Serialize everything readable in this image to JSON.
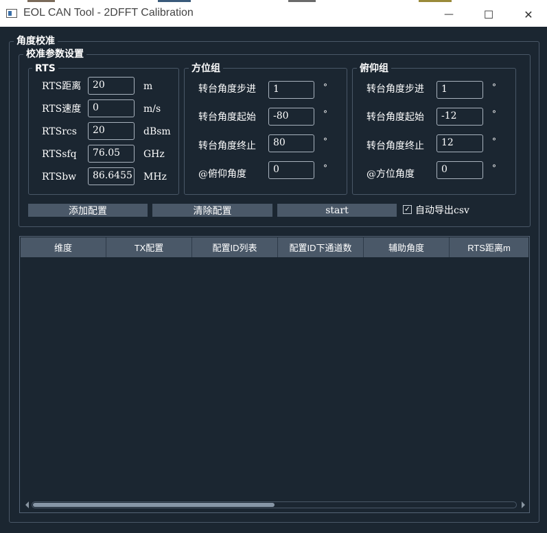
{
  "window": {
    "title": "EOL CAN Tool - 2DFFT Calibration",
    "minimize_symbol": "—",
    "maximize_symbol": "☐",
    "close_symbol": "✕"
  },
  "main_group": {
    "title": "角度校准"
  },
  "param_group": {
    "title": "校准参数设置"
  },
  "rts": {
    "title": "RTS",
    "distance": {
      "label": "RTS距离",
      "value": "20",
      "unit": "m"
    },
    "speed": {
      "label": "RTS速度",
      "value": "0",
      "unit": "m/s"
    },
    "rcs": {
      "label": "RTSrcs",
      "value": "20",
      "unit": "dBsm"
    },
    "sfq": {
      "label": "RTSsfq",
      "value": "76.05",
      "unit": "GHz"
    },
    "bw": {
      "label": "RTSbw",
      "value": "86.6455",
      "unit": "MHz"
    }
  },
  "azimuth": {
    "title": "方位组",
    "step": {
      "label": "转台角度步进",
      "value": "1",
      "unit": "°"
    },
    "start": {
      "label": "转台角度起始",
      "value": "-80",
      "unit": "°"
    },
    "end": {
      "label": "转台角度终止",
      "value": "80",
      "unit": "°"
    },
    "aux": {
      "label": "@俯仰角度",
      "value": "0",
      "unit": "°"
    }
  },
  "elevation": {
    "title": "俯仰组",
    "step": {
      "label": "转台角度步进",
      "value": "1",
      "unit": "°"
    },
    "start": {
      "label": "转台角度起始",
      "value": "-12",
      "unit": "°"
    },
    "end": {
      "label": "转台角度终止",
      "value": "12",
      "unit": "°"
    },
    "aux": {
      "label": "@方位角度",
      "value": "0",
      "unit": "°"
    }
  },
  "buttons": {
    "add": "添加配置",
    "clear": "清除配置",
    "start": "start"
  },
  "export_csv": {
    "label": "自动导出csv",
    "checked": true,
    "check_glyph": "✓"
  },
  "table": {
    "columns": [
      "维度",
      "TX配置",
      "配置ID列表",
      "配置ID下通道数",
      "辅助角度",
      "RTS距离m"
    ],
    "rows": [],
    "scroll_fraction": 0.5
  },
  "colors": {
    "background": "#1b2631",
    "header": "#4a5868",
    "button": "#4a5868",
    "border": "#4a5868"
  }
}
